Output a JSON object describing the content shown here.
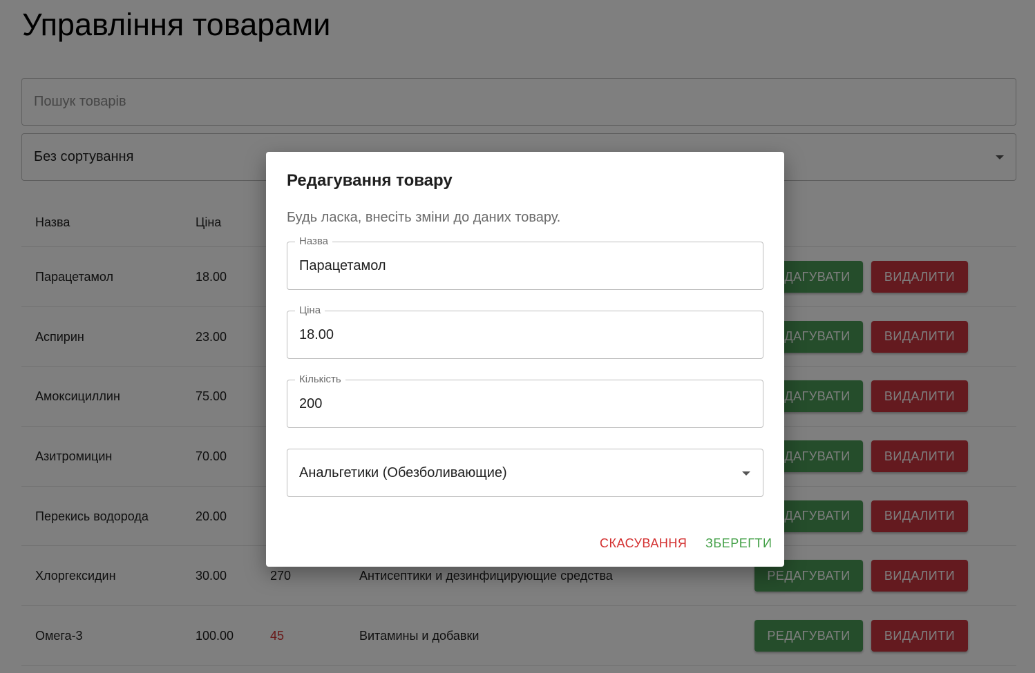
{
  "page": {
    "title": "Управління товарами"
  },
  "search": {
    "placeholder": "Пошук товарів"
  },
  "sort": {
    "value": "Без сортування"
  },
  "table": {
    "headers": {
      "name": "Назва",
      "price": "Ціна"
    },
    "edit_label": "РЕДАГУВАТИ",
    "delete_label": "ВИДАЛИТИ",
    "rows": [
      {
        "name": "Парацетамол",
        "price": "18.00",
        "qty": "",
        "category": ""
      },
      {
        "name": "Аспирин",
        "price": "23.00",
        "qty": "",
        "category": ""
      },
      {
        "name": "Амоксициллин",
        "price": "75.00",
        "qty": "",
        "category": ""
      },
      {
        "name": "Азитромицин",
        "price": "70.00",
        "qty": "",
        "category": ""
      },
      {
        "name": "Перекись водорода",
        "price": "20.00",
        "qty": "",
        "category": ""
      },
      {
        "name": "Хлоргексидин",
        "price": "30.00",
        "qty": "270",
        "category": "Антисептики и дезинфицирующие средства"
      },
      {
        "name": "Омега-3",
        "price": "100.00",
        "qty": "45",
        "category": "Витамины и добавки"
      }
    ]
  },
  "dialog": {
    "title": "Редагування товару",
    "text": "Будь ласка, внесіть зміни до даних товару.",
    "fields": {
      "name": {
        "label": "Назва",
        "value": "Парацетамол"
      },
      "price": {
        "label": "Ціна",
        "value": "18.00"
      },
      "qty": {
        "label": "Кількість",
        "value": "200"
      },
      "category": {
        "value": "Анальгетики (Обезболивающие)"
      }
    },
    "cancel_label": "СКАСУВАННЯ",
    "save_label": "ЗБЕРЕГТИ"
  },
  "colors": {
    "edit_button": "#4a9a57",
    "delete_button": "#c9353f",
    "low_stock": "#d32f2f",
    "cancel": "#d32f2f",
    "save": "#43a047"
  }
}
